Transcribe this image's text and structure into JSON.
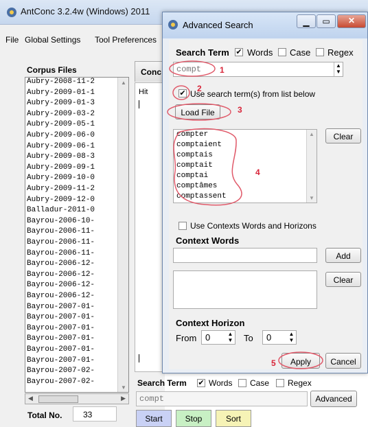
{
  "main_window": {
    "title": "AntConc 3.2.4w (Windows) 2011",
    "menu": [
      "File",
      "Global Settings",
      "Tool Preferences"
    ],
    "corpus_files_label": "Corpus Files",
    "corpus_files": [
      "Aubry-2008-11-2",
      "Aubry-2009-01-1",
      "Aubry-2009-01-3",
      "Aubry-2009-03-2",
      "Aubry-2009-05-1",
      "Aubry-2009-06-0",
      "Aubry-2009-06-1",
      "Aubry-2009-08-3",
      "Aubry-2009-09-1",
      "Aubry-2009-10-0",
      "Aubry-2009-11-2",
      "Aubry-2009-12-0",
      "Balladur-2011-0",
      "Bayrou-2006-10-",
      "Bayrou-2006-11-",
      "Bayrou-2006-11-",
      "Bayrou-2006-11-",
      "Bayrou-2006-12-",
      "Bayrou-2006-12-",
      "Bayrou-2006-12-",
      "Bayrou-2006-12-",
      "Bayrou-2007-01-",
      "Bayrou-2007-01-",
      "Bayrou-2007-01-",
      "Bayrou-2007-01-",
      "Bayrou-2007-01-",
      "Bayrou-2007-01-",
      "Bayrou-2007-02-",
      "Bayrou-2007-02-"
    ],
    "total_label": "Total No.",
    "total_value": "33",
    "tab_label": "Conc",
    "hit_label": "Hit",
    "bottom": {
      "search_term_label": "Search Term",
      "words_label": "Words",
      "case_label": "Case",
      "regex_label": "Regex",
      "search_value": "compt",
      "advanced_label": "Advanced",
      "start_label": "Start",
      "stop_label": "Stop",
      "sort_label": "Sort"
    }
  },
  "dialog": {
    "title": "Advanced Search",
    "search_term_label": "Search Term",
    "words_label": "Words",
    "case_label": "Case",
    "regex_label": "Regex",
    "search_value": "compt",
    "use_list_label": "Use search term(s) from list below",
    "load_file_label": "Load File",
    "terms": [
      "compter",
      "comptaient",
      "comptais",
      "comptait",
      "comptai",
      "comptâmes",
      "comptassent"
    ],
    "clear_label": "Clear",
    "use_contexts_label": "Use Contexts Words and Horizons",
    "context_words_label": "Context Words",
    "add_label": "Add",
    "clear2_label": "Clear",
    "context_horizon_label": "Context Horizon",
    "from_label": "From",
    "from_value": "0",
    "to_label": "To",
    "to_value": "0",
    "apply_label": "Apply",
    "cancel_label": "Cancel"
  },
  "annotations": [
    "1",
    "2",
    "3",
    "4",
    "5"
  ],
  "colors": {
    "annotation": "#d8263a",
    "start": "#c9d1f5",
    "stop": "#c8f0c4",
    "sort": "#f6f3b6"
  }
}
